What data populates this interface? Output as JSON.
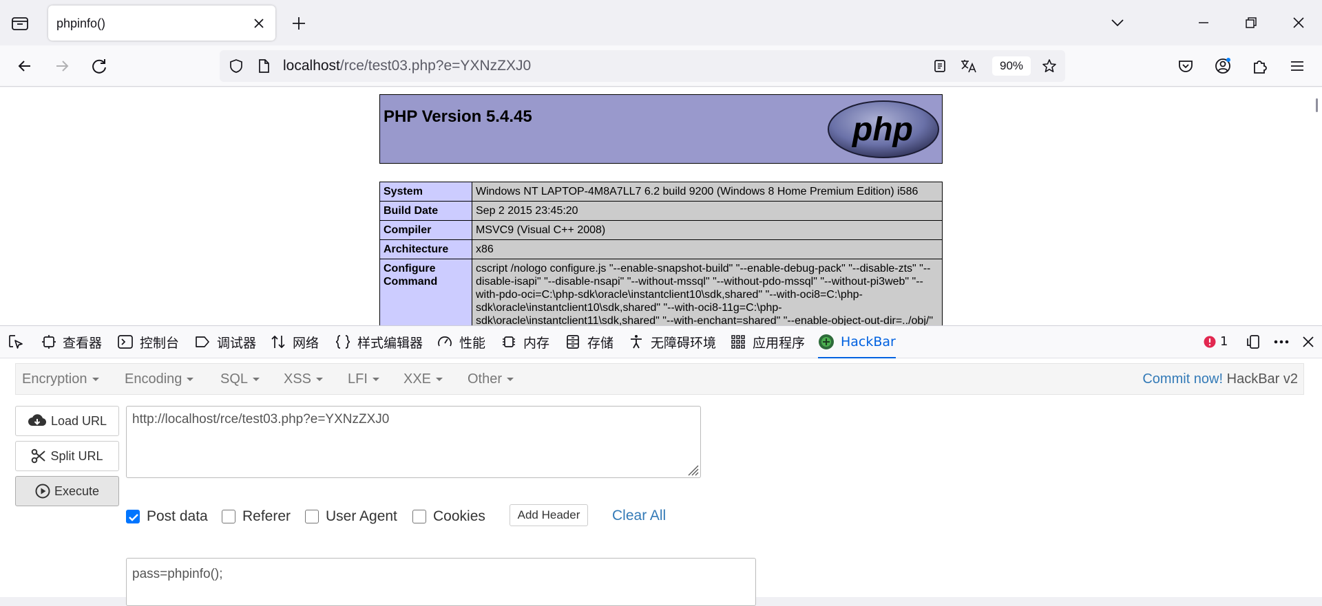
{
  "browser": {
    "tab_title": "phpinfo()",
    "url_host": "localhost",
    "url_path": "/rce/test03.php?e=YXNzZXJ0",
    "zoom": "90%"
  },
  "phpinfo": {
    "version_title": "PHP Version 5.4.45",
    "logo_text": "php",
    "rows": [
      {
        "key": "System",
        "value": "Windows NT LAPTOP-4M8A7LL7 6.2 build 9200 (Windows 8 Home Premium Edition) i586"
      },
      {
        "key": "Build Date",
        "value": "Sep 2 2015 23:45:20"
      },
      {
        "key": "Compiler",
        "value": "MSVC9 (Visual C++ 2008)"
      },
      {
        "key": "Architecture",
        "value": "x86"
      },
      {
        "key": "Configure Command",
        "value": "cscript /nologo configure.js \"--enable-snapshot-build\" \"--enable-debug-pack\" \"--disable-zts\" \"--disable-isapi\" \"--disable-nsapi\" \"--without-mssql\" \"--without-pdo-mssql\" \"--without-pi3web\" \"--with-pdo-oci=C:\\php-sdk\\oracle\\instantclient10\\sdk,shared\" \"--with-oci8=C:\\php-sdk\\oracle\\instantclient10\\sdk,shared\" \"--with-oci8-11g=C:\\php-sdk\\oracle\\instantclient11\\sdk,shared\" \"--with-enchant=shared\" \"--enable-object-out-dir=../obj/\""
      }
    ]
  },
  "devtools": {
    "tabs": [
      "查看器",
      "控制台",
      "调试器",
      "网络",
      "样式编辑器",
      "性能",
      "内存",
      "存储",
      "无障碍环境",
      "应用程序",
      "HackBar"
    ],
    "error_count": "1"
  },
  "hackbar": {
    "menu": [
      "Encryption",
      "Encoding",
      "SQL",
      "XSS",
      "LFI",
      "XXE",
      "Other"
    ],
    "commit_link": "Commit now!",
    "version": "HackBar v2",
    "load_url": "Load URL",
    "split_url": "Split URL",
    "execute": "Execute",
    "url_value": "http://localhost/rce/test03.php?e=YXNzZXJ0",
    "options": {
      "post_data": "Post data",
      "referer": "Referer",
      "user_agent": "User Agent",
      "cookies": "Cookies"
    },
    "add_header": "Add Header",
    "clear_all": "Clear All",
    "post_value": "pass=phpinfo();"
  },
  "colors": {
    "php_header": "#9999cc",
    "php_key_bg": "#ccccff",
    "php_value_bg": "#cccccc",
    "active_tab": "#0061e0",
    "link_blue": "#337ab7"
  }
}
